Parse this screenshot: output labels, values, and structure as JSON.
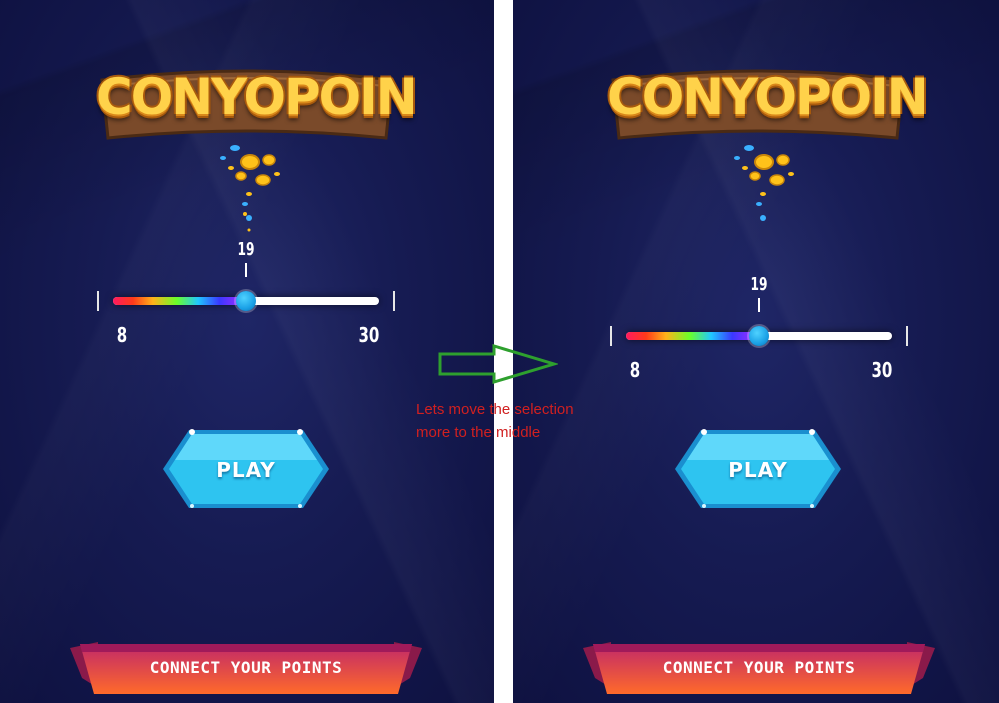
{
  "screens": [
    {
      "logo": "CONYOPOIN",
      "slider": {
        "value": "19",
        "min": "8",
        "max": "30",
        "fill_fraction": 0.5
      },
      "play_label": "PLAY",
      "connect_label": "CONNECT YOUR POINTS"
    },
    {
      "logo": "CONYOPOIN",
      "slider": {
        "value": "19",
        "min": "8",
        "max": "30",
        "fill_fraction": 0.5
      },
      "play_label": "PLAY",
      "connect_label": "CONNECT YOUR POINTS"
    }
  ],
  "annotation": {
    "note_line1": "Lets move the selection",
    "note_line2": "more to the middle",
    "arrow_color": "#2ea02e",
    "note_color": "#d02020"
  },
  "colors": {
    "background": "#161b52",
    "logo_text": "#ffd24a",
    "logo_board": "#7a4a2a",
    "play_button": "#2ec4f0",
    "ribbon_top": "#c0286a",
    "ribbon_bottom": "#ff6a2a",
    "thumb": "#1aa0e6"
  }
}
